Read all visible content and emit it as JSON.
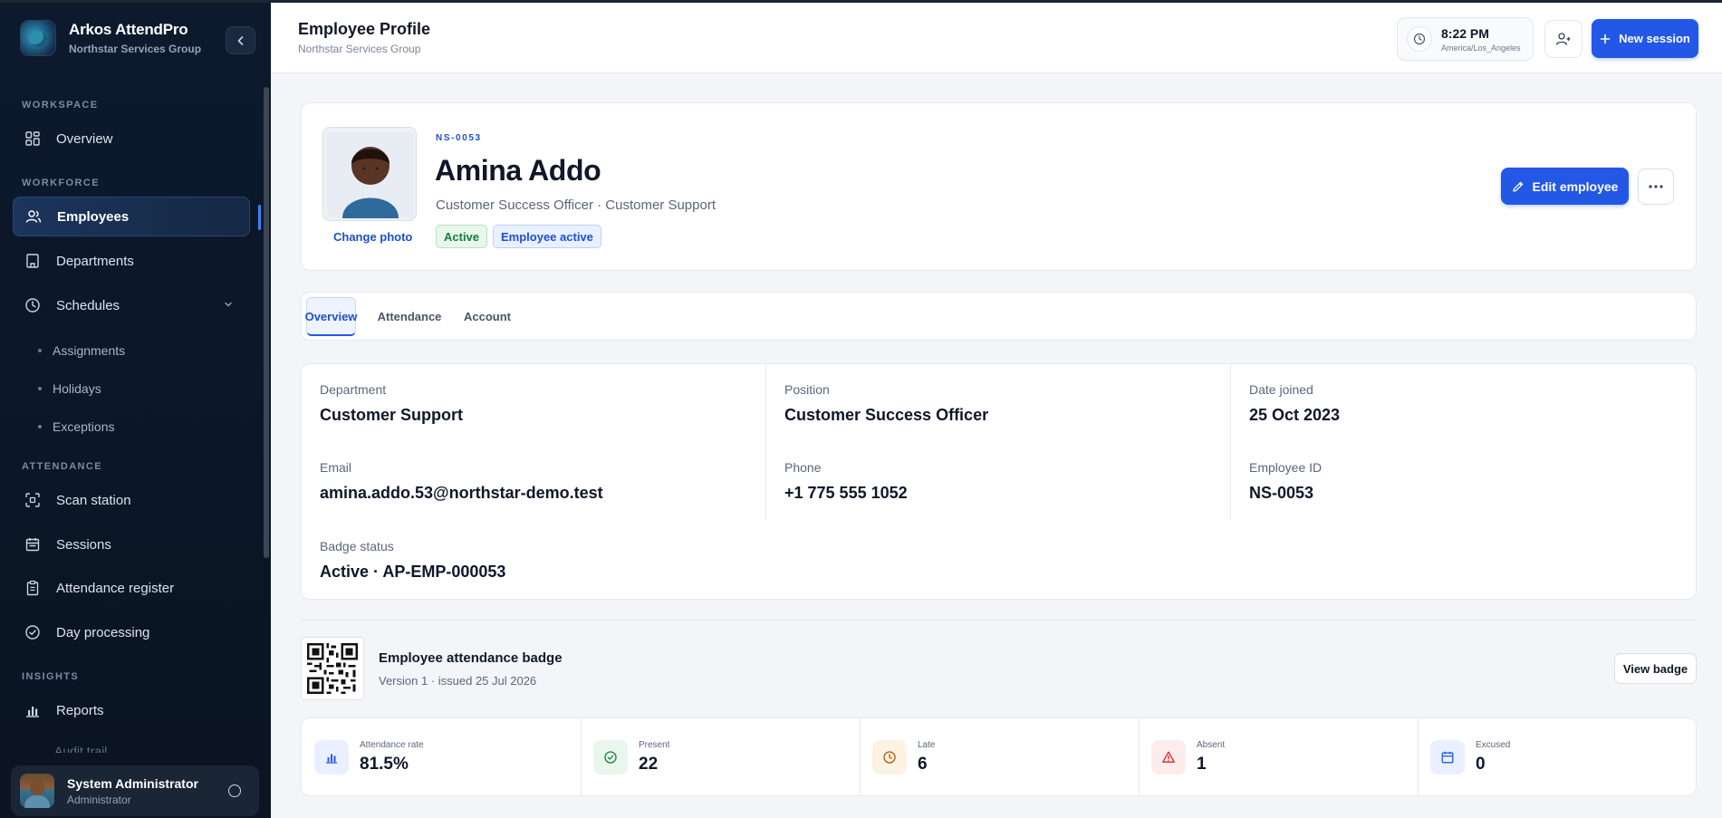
{
  "app": {
    "name": "Arkos AttendPro",
    "org": "Northstar Services Group"
  },
  "sidebar": {
    "sections": {
      "workspace": "WORKSPACE",
      "workforce": "WORKFORCE",
      "attendance": "ATTENDANCE",
      "insights": "INSIGHTS"
    },
    "items": {
      "overview": "Overview",
      "employees": "Employees",
      "departments": "Departments",
      "schedules": "Schedules",
      "assignments": "Assignments",
      "holidays": "Holidays",
      "exceptions": "Exceptions",
      "scan_station": "Scan station",
      "sessions": "Sessions",
      "attendance_register": "Attendance register",
      "day_processing": "Day processing",
      "reports": "Reports",
      "audit_trail_partial": "Audit trail"
    },
    "user": {
      "name": "System Administrator",
      "role": "Administrator"
    }
  },
  "header": {
    "title": "Employee Profile",
    "subtitle": "Northstar Services Group",
    "clock": {
      "time": "8:22 PM",
      "timezone": "America/Los_Angeles"
    },
    "new_session_label": "New session"
  },
  "profile": {
    "code": "NS-0053",
    "name": "Amina Addo",
    "role_line": "Customer Success Officer · Customer Support",
    "change_photo_label": "Change photo",
    "badges": [
      "Active",
      "Employee active"
    ],
    "edit_label": "Edit employee",
    "more_label": "···"
  },
  "tabs": [
    "Overview",
    "Attendance",
    "Account"
  ],
  "details": {
    "department_label": "Department",
    "department": "Customer Support",
    "position_label": "Position",
    "position": "Customer Success Officer",
    "date_joined_label": "Date joined",
    "date_joined": "25 Oct 2023",
    "email_label": "Email",
    "email": "amina.addo.53@northstar-demo.test",
    "phone_label": "Phone",
    "phone": "+1 775 555 1052",
    "employee_id_label": "Employee ID",
    "employee_id": "NS-0053",
    "badge_status_label": "Badge status",
    "badge_status": "Active · AP-EMP-000053"
  },
  "badge_card": {
    "title": "Employee attendance badge",
    "meta": "Version 1 · issued 25 Jul 2026",
    "view_label": "View badge"
  },
  "stats": [
    {
      "label": "Attendance rate",
      "value": "81.5%",
      "icon": "bar-chart-icon",
      "color": "#2358e6"
    },
    {
      "label": "Present",
      "value": "22",
      "icon": "check-circle-icon",
      "color": "#15803d"
    },
    {
      "label": "Late",
      "value": "6",
      "icon": "clock-icon",
      "color": "#b45309"
    },
    {
      "label": "Absent",
      "value": "1",
      "icon": "alert-triangle-icon",
      "color": "#dc2626"
    },
    {
      "label": "Excused",
      "value": "0",
      "icon": "calendar-icon",
      "color": "#2358e6"
    }
  ]
}
